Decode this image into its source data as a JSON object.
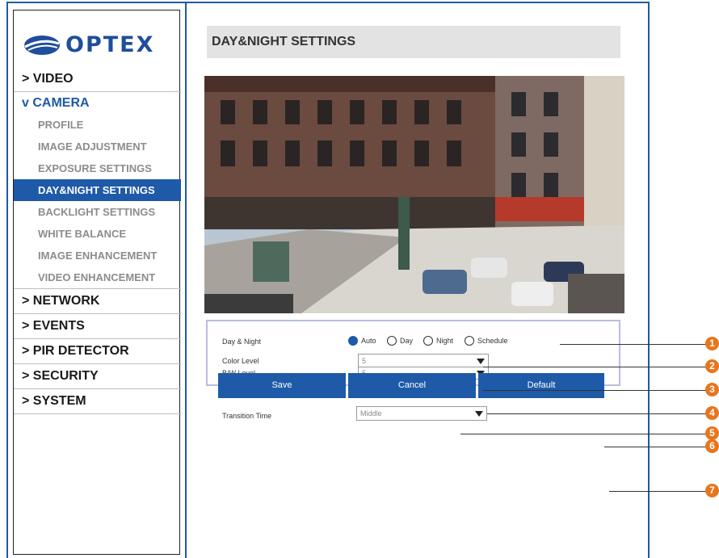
{
  "brand": {
    "name": "OPTEX",
    "logo_color": "#1f4e9c"
  },
  "accent_color": "#1e5aa8",
  "sidebar": {
    "items": [
      {
        "label": "> VIDEO"
      },
      {
        "label": "v CAMERA"
      },
      {
        "label": "PROFILE"
      },
      {
        "label": "IMAGE ADJUSTMENT"
      },
      {
        "label": "EXPOSURE SETTINGS"
      },
      {
        "label": "DAY&NIGHT SETTINGS",
        "active": true
      },
      {
        "label": "BACKLIGHT SETTINGS"
      },
      {
        "label": "WHITE BALANCE"
      },
      {
        "label": "IMAGE ENHANCEMENT"
      },
      {
        "label": "VIDEO ENHANCEMENT"
      },
      {
        "label": "> NETWORK"
      },
      {
        "label": "> EVENTS"
      },
      {
        "label": "> PIR DETECTOR"
      },
      {
        "label": "> SECURITY"
      },
      {
        "label": "> SYSTEM"
      }
    ]
  },
  "page": {
    "title": "DAY&NIGHT SETTINGS"
  },
  "form": {
    "day_night": {
      "label": "Day & Night",
      "options": [
        "Auto",
        "Day",
        "Night",
        "Schedule"
      ],
      "selected": "Auto"
    },
    "color_level": {
      "label": "Color Level",
      "value": "5"
    },
    "bw_level": {
      "label": "B/W Level",
      "value": "5"
    },
    "transition_time": {
      "label": "Transition Time",
      "value": "Middle"
    }
  },
  "buttons": {
    "save": "Save",
    "cancel": "Cancel",
    "default": "Default"
  },
  "callouts": [
    "1",
    "2",
    "3",
    "4",
    "5",
    "6",
    "7"
  ],
  "callout_color": "#e8761e"
}
